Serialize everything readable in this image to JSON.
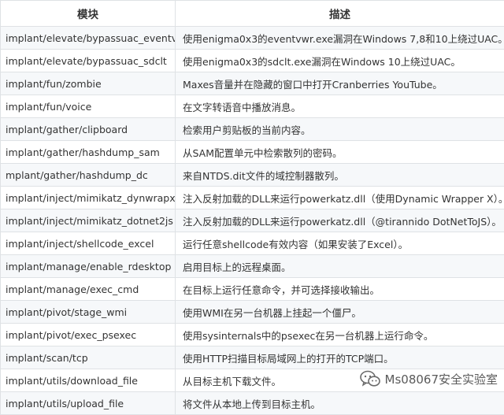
{
  "table": {
    "headers": [
      "模块",
      "描述"
    ],
    "rows": [
      [
        "implant/elevate/bypassuac_eventvwr",
        "使用enigma0x3的eventvwr.exe漏洞在Windows 7,8和10上绕过UAC。"
      ],
      [
        "implant/elevate/bypassuac_sdclt",
        "使用enigma0x3的sdclt.exe漏洞在Windows 10上绕过UAC。"
      ],
      [
        "implant/fun/zombie",
        "Maxes音量并在隐藏的窗口中打开Cranberries YouTube。"
      ],
      [
        "implant/fun/voice",
        "在文字转语音中播放消息。"
      ],
      [
        "implant/gather/clipboard",
        "检索用户剪贴板的当前内容。"
      ],
      [
        "implant/gather/hashdump_sam",
        "从SAM配置单元中检索散列的密码。"
      ],
      [
        "mplant/gather/hashdump_dc",
        "来自NTDS.dit文件的域控制器散列。"
      ],
      [
        "implant/inject/mimikatz_dynwrapx",
        "注入反射加载的DLL来运行powerkatz.dll（使用Dynamic Wrapper X）。"
      ],
      [
        "implant/inject/mimikatz_dotnet2js",
        "注入反射加载的DLL来运行powerkatz.dll（@tirannido DotNetToJS）。"
      ],
      [
        "implant/inject/shellcode_excel",
        "运行任意shellcode有效内容（如果安装了Excel）。"
      ],
      [
        "implant/manage/enable_rdesktop",
        "启用目标上的远程桌面。"
      ],
      [
        "implant/manage/exec_cmd",
        "在目标上运行任意命令，并可选择接收输出。"
      ],
      [
        "implant/pivot/stage_wmi",
        "使用WMI在另一台机器上挂起一个僵尸。"
      ],
      [
        "implant/pivot/exec_psexec",
        "使用sysinternals中的psexec在另一台机器上运行命令。"
      ],
      [
        "implant/scan/tcp",
        "使用HTTP扫描目标局域网上的打开的TCP端口。"
      ],
      [
        "implant/utils/download_file",
        "从目标主机下载文件。"
      ],
      [
        "implant/utils/upload_file",
        "将文件从本地上传到目标主机。"
      ]
    ]
  },
  "watermark": {
    "text": "Ms08067安全实验室",
    "icon": "wechat-icon"
  }
}
